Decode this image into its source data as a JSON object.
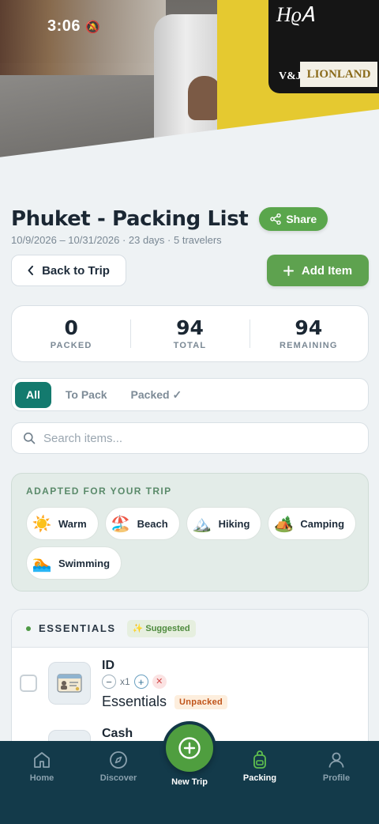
{
  "status_bar": {
    "time": "3:06"
  },
  "header": {
    "title": "Phuket - Packing List",
    "share_label": "Share",
    "subtitle": "10/9/2026 – 10/31/2026 · 23 days · 5 travelers"
  },
  "actions": {
    "back_label": "Back to Trip",
    "add_label": "Add Item"
  },
  "stats": [
    {
      "value": "0",
      "label": "PACKED"
    },
    {
      "value": "94",
      "label": "TOTAL"
    },
    {
      "value": "94",
      "label": "REMAINING"
    }
  ],
  "filter_tabs": [
    {
      "label": "All",
      "active": true
    },
    {
      "label": "To Pack",
      "active": false
    },
    {
      "label": "Packed ✓",
      "active": false
    }
  ],
  "search": {
    "placeholder": "Search items..."
  },
  "adapted": {
    "heading": "ADAPTED FOR YOUR TRIP",
    "chips": [
      {
        "label": "Warm",
        "icon": "sun-icon"
      },
      {
        "label": "Beach",
        "icon": "beach-icon"
      },
      {
        "label": "Hiking",
        "icon": "mountain-icon"
      },
      {
        "label": "Camping",
        "icon": "tent-icon"
      },
      {
        "label": "Swimming",
        "icon": "swimmer-icon"
      }
    ]
  },
  "essentials": {
    "title": "ESSENTIALS",
    "badge": "✨ Suggested",
    "items": [
      {
        "name": "ID",
        "qty": "x1",
        "category": "Essentials",
        "status": "Unpacked",
        "icon": "id-card-icon"
      },
      {
        "name": "Cash",
        "icon": "cash-icon"
      }
    ]
  },
  "nav": {
    "items": [
      {
        "label": "Home",
        "icon": "home-icon",
        "active": false
      },
      {
        "label": "Discover",
        "icon": "compass-icon",
        "active": false
      },
      {
        "label": "New Trip",
        "icon": "plus-circle-icon",
        "active": false
      },
      {
        "label": "Packing",
        "icon": "backpack-icon",
        "active": true
      },
      {
        "label": "Profile",
        "icon": "user-icon",
        "active": false
      }
    ]
  },
  "colors": {
    "accent_green": "#5ea24f",
    "teal": "#137a6e",
    "nav_bg": "#133a4a",
    "unpacked_badge": "#c0541a"
  }
}
